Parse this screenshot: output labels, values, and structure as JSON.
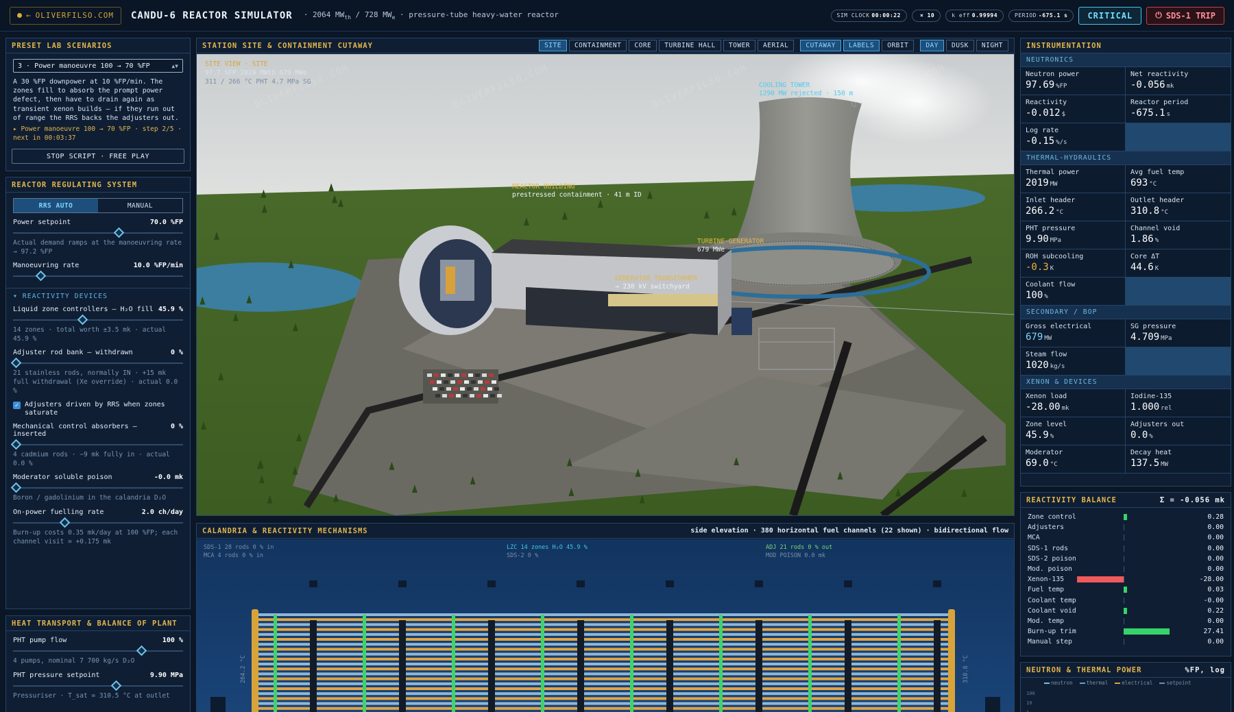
{
  "brand": {
    "label": "OLIVERFILSO.COM"
  },
  "app": {
    "title": "CANDU-6 REACTOR SIMULATOR",
    "mw_th": "2064 MW",
    "mw_th_sub": "th",
    "mw_e": "728 MW",
    "mw_e_sub": "e",
    "desc": "pressure-tube heavy-water reactor"
  },
  "status": {
    "sim_clock_label": "SIM CLOCK",
    "sim_clock": "00:00:22",
    "speed": "× 10",
    "keff_label": "k eff",
    "keff": "0.99994",
    "period_label": "PERIOD",
    "period": "-675.1 s",
    "critical": "CRITICAL",
    "trip": "SDS-1 TRIP"
  },
  "scenario": {
    "header": "PRESET LAB SCENARIOS",
    "selected": "3 · Power manoeuvre 100 → 70 %FP",
    "description": "A 30 %FP downpower at 10 %FP/min. The zones fill to absorb the prompt power defect, then have to drain again as transient xenon builds — if they run out of range the RRS backs the adjusters out.",
    "step": "▸ Power manoeuvre 100 → 70 %FP · step 2/5 · next in 00:03:37",
    "stop_button": "STOP SCRIPT · FREE PLAY"
  },
  "rrs": {
    "header": "REACTOR REGULATING SYSTEM",
    "mode_auto": "RRS AUTO",
    "mode_manual": "MANUAL",
    "setpoint": {
      "label": "Power setpoint",
      "value": "70.0 %FP",
      "fraction": 0.7,
      "note": "Actual demand ramps at the manoeuvring rate → 97.2 %FP"
    },
    "rate": {
      "label": "Manoeuvring rate",
      "value": "10.0 %FP/min",
      "fraction": 0.18
    },
    "devices_header": "▾ REACTIVITY DEVICES",
    "lzc": {
      "label": "Liquid zone controllers — H₂O fill",
      "value": "45.9 %",
      "fraction": 0.459,
      "note": "14 zones · total worth ±3.5 mk · actual 45.9 %"
    },
    "adj": {
      "label": "Adjuster rod bank — withdrawn",
      "value": "0 %",
      "fraction": 0.0,
      "note": "21 stainless rods, normally IN · +15 mk full withdrawal (Xe override) · actual 0.0 %"
    },
    "adj_check": "Adjusters driven by RRS when zones saturate",
    "mca": {
      "label": "Mechanical control absorbers — inserted",
      "value": "0 %",
      "fraction": 0.0,
      "note": "4 cadmium rods · −9 mk fully in · actual 0.0 %"
    },
    "poison": {
      "label": "Moderator soluble poison",
      "value": "-0.0 mk",
      "fraction": 0.0,
      "note": "Boron / gadolinium in the calandria D₂O"
    },
    "fuelling": {
      "label": "On-power fuelling rate",
      "value": "2.0 ch/day",
      "fraction": 0.34,
      "note": "Burn-up costs 0.35 mk/day at 100 %FP; each channel visit = +0.175 mk"
    }
  },
  "heat": {
    "header": "HEAT TRANSPORT & BALANCE OF PLANT",
    "pump": {
      "label": "PHT pump flow",
      "value": "100 %",
      "fraction": 0.85,
      "note": "4 pumps, nominal 7 700 kg/s D₂O"
    },
    "pressure": {
      "label": "PHT pressure setpoint",
      "value": "9.90 MPa",
      "fraction": 0.68,
      "note": "Pressuriser · T_sat = 310.5 °C at outlet"
    }
  },
  "viewport": {
    "header": "STATION SITE & CONTAINMENT CUTAWAY",
    "tabs": [
      "SITE",
      "CONTAINMENT",
      "CORE",
      "TURBINE HALL",
      "TOWER",
      "AERIAL",
      "CUTAWAY",
      "LABELS",
      "ORBIT",
      "DAY",
      "DUSK",
      "NIGHT"
    ],
    "active_tabs": [
      "SITE",
      "CUTAWAY",
      "LABELS",
      "DAY"
    ],
    "hud_title": "SITE VIEW · SITE",
    "hud_line1": "97.7 %FP   2019 MWth   679 MWe",
    "hud_line2": "311 / 266 °C PHT   4.7 MPa SG",
    "cooling_tower": "COOLING TOWER",
    "cooling_tower_desc": "1290 MW rejected · 150 m",
    "reactor_building": "REACTOR BUILDING",
    "reactor_building_desc": "prestressed containment · 41 m ID",
    "turbine": "TURBINE-GENERATOR",
    "turbine_desc": "679 MWe",
    "transformer": "GENERATOR TRANSFORMER",
    "transformer_desc": "→ 230 kV switchyard",
    "watermark": "OLIVERFILSO.COM"
  },
  "calandria": {
    "header": "CALANDRIA & REACTIVITY MECHANISMS",
    "sub": "side elevation · 380 horizontal fuel channels (22 shown) · bidirectional flow",
    "note_sds1": "SDS-1  28 rods  0 % in",
    "note_mca": "MCA  4 rods  0 % in",
    "note_lzc": "LZC  14 zones  H₂O 45.9 %",
    "note_sds2": "SDS-2  0 %",
    "note_adj": "ADJ  21 rods  0 % out",
    "note_mod": "MOD POISON  0.0 mk",
    "left_hdr": "264.2 °C",
    "right_hdr": "310.8 °C"
  },
  "instr": {
    "header": "INSTRUMENTATION",
    "groups": [
      {
        "title": "NEUTRONICS",
        "cells": [
          {
            "name": "Neutron power",
            "value": "97.69",
            "unit": "%FP"
          },
          {
            "name": "Net reactivity",
            "value": "-0.056",
            "unit": "mk"
          },
          {
            "name": "Reactivity",
            "value": "-0.012",
            "unit": "$"
          },
          {
            "name": "Reactor period",
            "value": "-675.1",
            "unit": "s"
          },
          {
            "name": "Log rate",
            "value": "-0.15",
            "unit": "%/s"
          },
          {
            "blank": true
          }
        ]
      },
      {
        "title": "THERMAL-HYDRAULICS",
        "cells": [
          {
            "name": "Thermal power",
            "value": "2019",
            "unit": "MW"
          },
          {
            "name": "Avg fuel temp",
            "value": "693",
            "unit": "°C"
          },
          {
            "name": "Inlet header",
            "value": "266.2",
            "unit": "°C"
          },
          {
            "name": "Outlet header",
            "value": "310.8",
            "unit": "°C"
          },
          {
            "name": "PHT pressure",
            "value": "9.90",
            "unit": "MPa"
          },
          {
            "name": "Channel void",
            "value": "1.86",
            "unit": "%"
          },
          {
            "name": "ROH subcooling",
            "value": "-0.3",
            "unit": "K",
            "style": "warn"
          },
          {
            "name": "Core ΔT",
            "value": "44.6",
            "unit": "K"
          },
          {
            "name": "Coolant flow",
            "value": "100",
            "unit": "%"
          },
          {
            "blank": true
          }
        ]
      },
      {
        "title": "SECONDARY / BOP",
        "cells": [
          {
            "name": "Gross electrical",
            "value": "679",
            "unit": "MW",
            "style": "cyan"
          },
          {
            "name": "SG pressure",
            "value": "4.709",
            "unit": "MPa"
          },
          {
            "name": "Steam flow",
            "value": "1020",
            "unit": "kg/s"
          },
          {
            "blank": true
          }
        ]
      },
      {
        "title": "XENON & DEVICES",
        "cells": [
          {
            "name": "Xenon load",
            "value": "-28.00",
            "unit": "mk"
          },
          {
            "name": "Iodine-135",
            "value": "1.000",
            "unit": "rel"
          },
          {
            "name": "Zone level",
            "value": "45.9",
            "unit": "%"
          },
          {
            "name": "Adjusters out",
            "value": "0.0",
            "unit": "%"
          },
          {
            "name": "Moderator",
            "value": "69.0",
            "unit": "°C"
          },
          {
            "name": "Decay heat",
            "value": "137.5",
            "unit": "MW"
          }
        ]
      }
    ]
  },
  "balance": {
    "header": "REACTIVITY BALANCE",
    "sum": "Σ = -0.056 mk",
    "rows": [
      {
        "name": "Zone control",
        "value": 0.28,
        "label": "0.28"
      },
      {
        "name": "Adjusters",
        "value": 0.0,
        "label": "0.00"
      },
      {
        "name": "MCA",
        "value": 0.0,
        "label": "0.00"
      },
      {
        "name": "SDS-1 rods",
        "value": 0.0,
        "label": "0.00"
      },
      {
        "name": "SDS-2 poison",
        "value": 0.0,
        "label": "0.00"
      },
      {
        "name": "Mod. poison",
        "value": 0.0,
        "label": "0.00"
      },
      {
        "name": "Xenon-135",
        "value": -28.0,
        "label": "-28.00"
      },
      {
        "name": "Fuel temp",
        "value": 0.03,
        "label": "0.03"
      },
      {
        "name": "Coolant temp",
        "value": -0.0,
        "label": "-0.00"
      },
      {
        "name": "Coolant void",
        "value": 0.22,
        "label": "0.22"
      },
      {
        "name": "Mod. temp",
        "value": 0.0,
        "label": "0.00"
      },
      {
        "name": "Burn-up trim",
        "value": 27.41,
        "label": "27.41"
      },
      {
        "name": "Manual step",
        "value": 0.0,
        "label": "0.00"
      }
    ],
    "colors": {
      "positive": "#35d46a",
      "negative": "#ef5a5a"
    }
  },
  "power": {
    "header": "NEUTRON & THERMAL POWER",
    "unit": "%FP, log",
    "legend": [
      "neutron",
      "thermal",
      "electrical",
      "setpoint"
    ],
    "ticks": [
      "100",
      "10",
      "1"
    ]
  }
}
